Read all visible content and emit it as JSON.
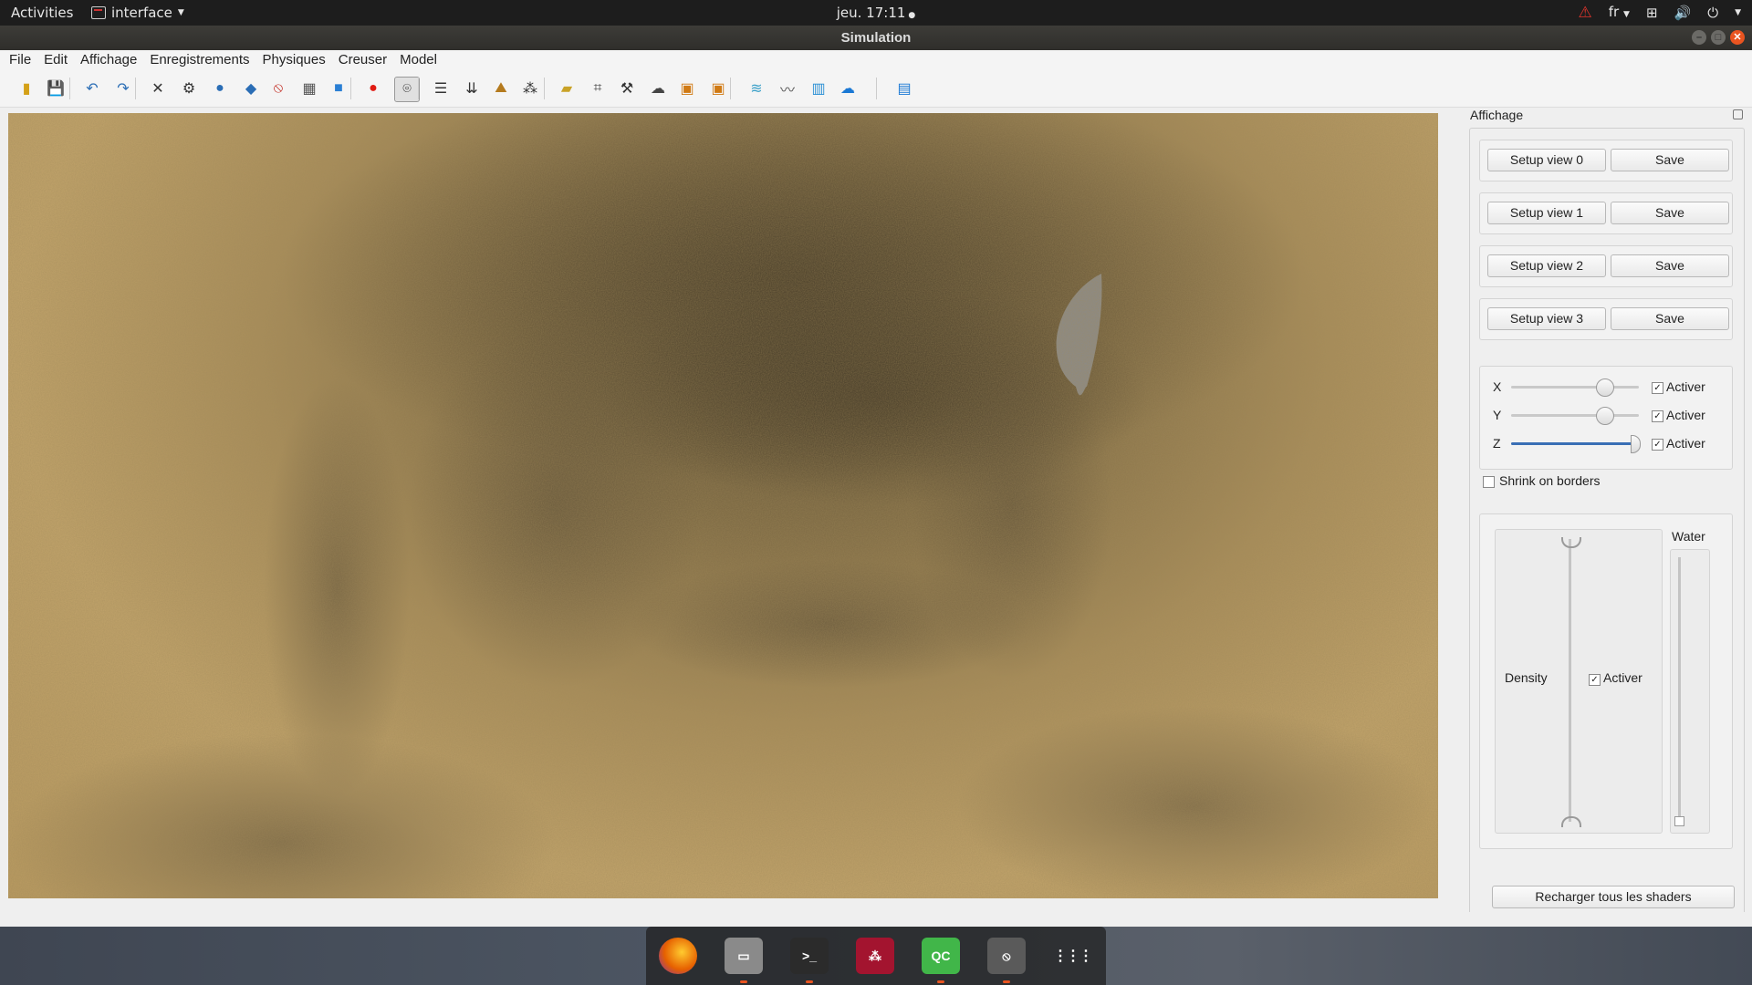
{
  "topbar": {
    "activities": "Activities",
    "app_name": "interface",
    "clock": "jeu. 17:11",
    "language": "fr",
    "icons": [
      "warning-icon",
      "network-icon",
      "volume-icon",
      "power-icon"
    ]
  },
  "window": {
    "title": "Simulation"
  },
  "menu": [
    "File",
    "Edit",
    "Affichage",
    "Enregistrements",
    "Physiques",
    "Creuser",
    "Model"
  ],
  "toolbar": {
    "tools": [
      {
        "name": "new-file-icon",
        "glyph": "▮",
        "color": "#d4a017"
      },
      {
        "name": "save-icon",
        "glyph": "💾",
        "color": "#2a6db5"
      },
      {
        "name": "undo-icon",
        "glyph": "↶",
        "color": "#2a6db5"
      },
      {
        "name": "redo-icon",
        "glyph": "↷",
        "color": "#2a6db5"
      },
      {
        "name": "bug-icon",
        "glyph": "✕",
        "color": "#333"
      },
      {
        "name": "settings-cog-icon",
        "glyph": "⚙",
        "color": "#333"
      },
      {
        "name": "sphere-icon",
        "glyph": "●",
        "color": "#2a6db5"
      },
      {
        "name": "blob-icon",
        "glyph": "◆",
        "color": "#2a6db5"
      },
      {
        "name": "no-entry-icon",
        "glyph": "⦸",
        "color": "#c0231a"
      },
      {
        "name": "grid-cube-icon",
        "glyph": "▦",
        "color": "#555"
      },
      {
        "name": "cube-icon",
        "glyph": "■",
        "color": "#2a7fd4"
      },
      {
        "name": "record-icon",
        "glyph": "●",
        "color": "#e01b12"
      },
      {
        "name": "camera-icon",
        "glyph": "⌾",
        "color": "#222",
        "active": true
      },
      {
        "name": "sliders-icon",
        "glyph": "☰",
        "color": "#333"
      },
      {
        "name": "down-arrows-icon",
        "glyph": "⇊",
        "color": "#333"
      },
      {
        "name": "terrain-icon",
        "glyph": "⛰",
        "color": "#b47a1e"
      },
      {
        "name": "particles-icon",
        "glyph": "⁂",
        "color": "#333"
      },
      {
        "name": "folder-icon",
        "glyph": "▰",
        "color": "#c9a227"
      },
      {
        "name": "crop-icon",
        "glyph": "⌗",
        "color": "#333"
      },
      {
        "name": "hammer-icon",
        "glyph": "⚒",
        "color": "#333"
      },
      {
        "name": "cloud-dark-icon",
        "glyph": "☁",
        "color": "#444"
      },
      {
        "name": "box-orange-icon",
        "glyph": "▣",
        "color": "#d07a14"
      },
      {
        "name": "box-orange-2-icon",
        "glyph": "▣",
        "color": "#d07a14"
      },
      {
        "name": "island-icon",
        "glyph": "≋",
        "color": "#3aa0c8"
      },
      {
        "name": "wave-icon",
        "glyph": "〰",
        "color": "#555"
      },
      {
        "name": "bars-icon",
        "glyph": "▥",
        "color": "#2a8fd4"
      },
      {
        "name": "cloud-blue-icon",
        "glyph": "☁",
        "color": "#1a78d4"
      },
      {
        "name": "map-icon",
        "glyph": "▤",
        "color": "#1a78d4"
      }
    ]
  },
  "dock": {
    "title": "Affichage",
    "views": [
      {
        "setup": "Setup view 0",
        "save": "Save"
      },
      {
        "setup": "Setup view 1",
        "save": "Save"
      },
      {
        "setup": "Setup view 2",
        "save": "Save"
      },
      {
        "setup": "Setup view 3",
        "save": "Save"
      }
    ],
    "axes": [
      {
        "label": "X",
        "level": 0.76,
        "active_label": "Activer",
        "checked": true
      },
      {
        "label": "Y",
        "level": 0.76,
        "active_label": "Activer",
        "checked": true
      },
      {
        "label": "Z",
        "level": 1.0,
        "active_label": "Activer",
        "checked": true
      }
    ],
    "shrink": {
      "label": "Shrink on borders",
      "checked": false
    },
    "density": {
      "label": "Density",
      "active_label": "Activer",
      "checked": true,
      "level": 1.0
    },
    "water": {
      "label": "Water",
      "level": 0.0
    },
    "reload_button": "Recharger tous les shaders"
  },
  "taskbar": {
    "apps": [
      {
        "name": "firefox-icon",
        "label": "",
        "color": "#e66000",
        "running": false
      },
      {
        "name": "file-manager-icon",
        "label": "",
        "color": "#8a8a8a",
        "running": true
      },
      {
        "name": "terminal-icon",
        "label": ">_",
        "color": "#2b2b2b",
        "running": true
      },
      {
        "name": "mendeley-icon",
        "label": "",
        "color": "#a3142f",
        "running": false
      },
      {
        "name": "qtcreator-icon",
        "label": "QC",
        "color": "#41b649",
        "running": true
      },
      {
        "name": "simulation-app-icon",
        "label": "",
        "color": "#5a5a5a",
        "running": true
      },
      {
        "name": "show-apps-icon",
        "label": "",
        "color": "transparent",
        "running": false
      }
    ]
  },
  "colors": {
    "accent": "#e95420",
    "slider_fill": "#3a6fb5",
    "sand": "#c2a46b"
  }
}
